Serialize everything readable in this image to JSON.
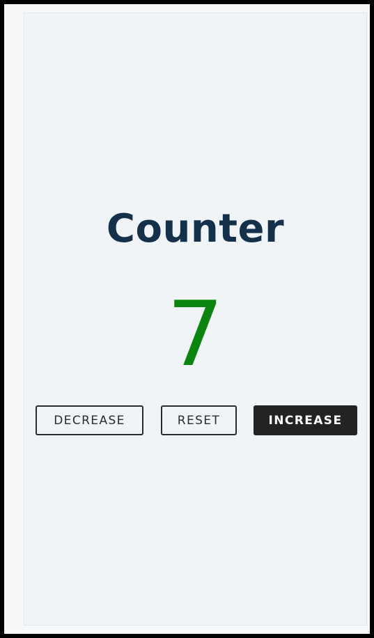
{
  "app": {
    "title": "Counter",
    "count": "7",
    "count_color": "#0b850f",
    "title_color": "#14304b"
  },
  "controls": {
    "decrease_label": "DECREASE",
    "reset_label": "RESET",
    "increase_label": "INCREASE"
  }
}
